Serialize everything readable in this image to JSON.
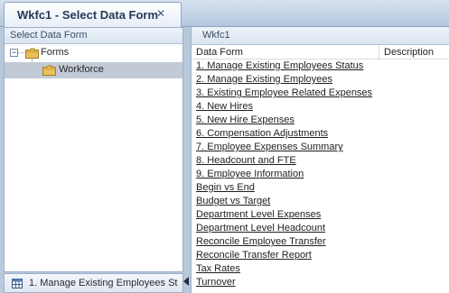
{
  "tab": {
    "title": "Wkfc1 - Select Data Form",
    "close_glyph": "✕"
  },
  "left_panel": {
    "header": "Select Data Form",
    "tree": {
      "root": {
        "label": "Forms",
        "expander": "−",
        "icon": "folder-icon"
      },
      "child": {
        "label": "Workforce",
        "icon": "folder-icon",
        "selected": true
      }
    }
  },
  "bottom_bar": {
    "icon": "form-grid-icon",
    "label": "1. Manage Existing Employees St"
  },
  "right_panel": {
    "header": "Wkfc1",
    "columns": [
      "Data Form",
      "Description"
    ],
    "forms": [
      "1. Manage Existing Employees Status",
      "2. Manage Existing Employees",
      "3. Existing Employee Related Expenses",
      "4. New Hires",
      "5. New Hire Expenses",
      "6. Compensation Adjustments",
      "7. Employee Expenses Summary",
      "8. Headcount and FTE",
      "9. Employee Information",
      "Begin vs End",
      "Budget vs Target",
      "Department Level Expenses",
      "Department Level Headcount",
      "Reconcile Employee Transfer",
      "Reconcile Transfer Report",
      "Tax Rates",
      "Turnover"
    ]
  },
  "colors": {
    "selection": "#c2cad6",
    "header_bg": "#d9e4f0",
    "folder": "#e2b23a"
  }
}
